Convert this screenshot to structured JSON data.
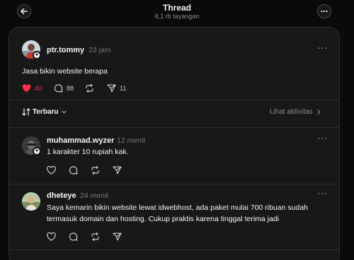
{
  "header": {
    "title": "Thread",
    "subtitle": "8,1 rb tayangan"
  },
  "post": {
    "username": "ptr.tommy",
    "time": "23 jam",
    "text": "Jasa bikin website berapa",
    "likes": "40",
    "comments": "88",
    "shares": "11"
  },
  "filter": {
    "sort_label": "Terbaru",
    "activity_label": "Lihat aktivitas"
  },
  "replies": [
    {
      "username": "muhammad.wyzer",
      "time": "12 menit",
      "text": "1 karakter 10 rupiah kak."
    },
    {
      "username": "dheteye",
      "time": "24 menit",
      "text_line1": "Saya kemarin bikin website lewat idwebhost, ada paket mulai 700 ribuan sudah",
      "text_line2": "termasuk domain dan hosting. Cukup praktis karena tinggal terima jadi"
    }
  ],
  "colors": {
    "background": "#0a0a0a",
    "card": "#181818",
    "like_active": "#ff3040",
    "muted_text": "#777777"
  }
}
